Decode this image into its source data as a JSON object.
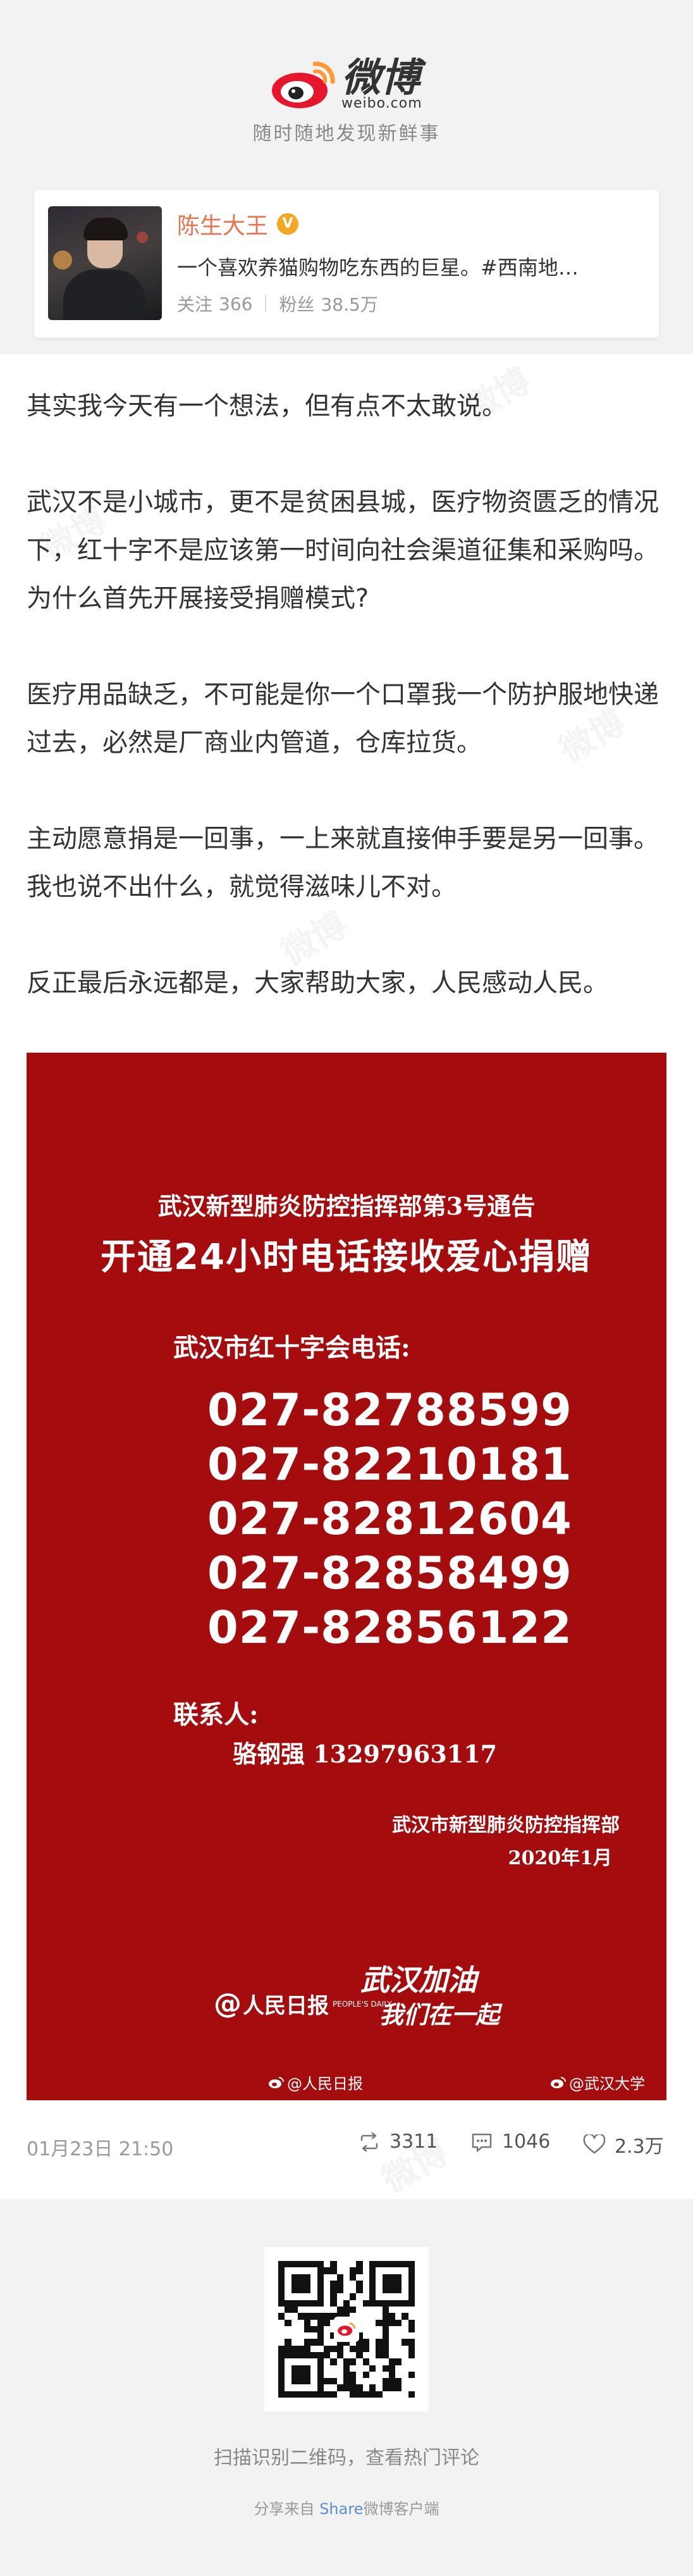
{
  "header": {
    "logo_cn": "微博",
    "logo_en": "weibo.com",
    "slogan": "随时随地发现新鲜事"
  },
  "profile": {
    "name": "陈生大王",
    "verified_badge": "V",
    "bio": "一个喜欢养猫购物吃东西的巨星。#西南地…",
    "following_label": "关注",
    "following_count": "366",
    "followers_label": "粉丝",
    "followers_count": "38.5万"
  },
  "post": {
    "paragraphs": [
      "其实我今天有一个想法，但有点不太敢说。",
      "武汉不是小城市，更不是贫困县城，医疗物资匮乏的情况下，红十字不是应该第一时间向社会渠道征集和采购吗。为什么首先开展接受捐赠模式?",
      "医疗用品缺乏，不可能是你一个口罩我一个防护服地快递过去，必然是厂商业内管道，仓库拉货。",
      "主动愿意捐是一回事，一上来就直接伸手要是另一回事。我也说不出什么，就觉得滋味儿不对。",
      "反正最后永远都是，大家帮助大家，人民感动人民。"
    ],
    "watermark_text": "微博"
  },
  "poster": {
    "subtitle": "武汉新型肺炎防控指挥部第3号通告",
    "title": "开通24小时电话接收爱心捐赠",
    "redcross_label": "武汉市红十字会电话:",
    "phones": [
      "027-82788599",
      "027-82210181",
      "027-82812604",
      "027-82858499",
      "027-82856122"
    ],
    "contact_label": "联系人:",
    "contact_person": "骆钢强 13297963117",
    "org": "武汉市新型肺炎防控指挥部",
    "date": "2020年1月",
    "daily_logo": "人民日报",
    "daily_logo_en": "PEOPLE'S DAILY",
    "slogan_line1": "武汉加油",
    "slogan_line2": "我们在一起",
    "watermark_left": "@人民日报",
    "watermark_right": "@武汉大学"
  },
  "stats": {
    "date": "01月23日 21:50",
    "reposts": "3311",
    "comments": "1046",
    "likes": "2.3万"
  },
  "footer": {
    "qr_tip": "扫描识别二维码，查看热门评论",
    "share_prefix": "分享来自",
    "share_link": "Share",
    "share_suffix": "微博客户端"
  },
  "colors": {
    "accent": "#eb7350",
    "poster_red": "#a50c0e",
    "weibo_red": "#e6162d",
    "weibo_orange": "#ff9933",
    "link_blue": "#5b8ed6"
  }
}
